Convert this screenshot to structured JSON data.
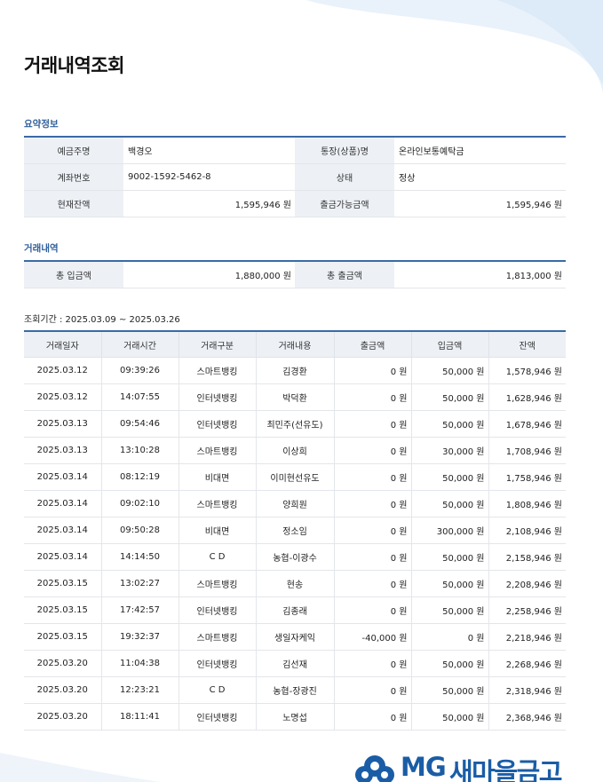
{
  "page": {
    "title": "거래내역조회"
  },
  "summary": {
    "section_title": "요약정보",
    "rows": [
      {
        "label1": "예금주명",
        "value1": "백경오",
        "label2": "통장(상품)명",
        "value2": "온라인보통예탁금"
      },
      {
        "label1": "계좌번호",
        "value1": "9002-1592-5462-8",
        "label2": "상태",
        "value2": "정상"
      },
      {
        "label1": "현재잔액",
        "value1": "1,595,946 원",
        "label2": "출금가능금액",
        "value2": "1,595,946 원"
      }
    ]
  },
  "totals": {
    "section_title": "거래내역",
    "deposit_label": "총 입금액",
    "deposit_value": "1,880,000 원",
    "withdraw_label": "총 출금액",
    "withdraw_value": "1,813,000 원"
  },
  "period": {
    "text": "조회기간 : 2025.03.09 ~ 2025.03.26"
  },
  "transactions": {
    "headers": [
      "거래일자",
      "거래시간",
      "거래구분",
      "거래내용",
      "출금액",
      "입금액",
      "잔액"
    ],
    "rows": [
      [
        "2025.03.12",
        "09:39:26",
        "스마트뱅킹",
        "김경환",
        "0 원",
        "50,000 원",
        "1,578,946 원"
      ],
      [
        "2025.03.12",
        "14:07:55",
        "인터넷뱅킹",
        "박덕환",
        "0 원",
        "50,000 원",
        "1,628,946 원"
      ],
      [
        "2025.03.13",
        "09:54:46",
        "인터넷뱅킹",
        "최민주(선유도)",
        "0 원",
        "50,000 원",
        "1,678,946 원"
      ],
      [
        "2025.03.13",
        "13:10:28",
        "스마트뱅킹",
        "이상희",
        "0 원",
        "30,000 원",
        "1,708,946 원"
      ],
      [
        "2025.03.14",
        "08:12:19",
        "비대면",
        "이미현선유도",
        "0 원",
        "50,000 원",
        "1,758,946 원"
      ],
      [
        "2025.03.14",
        "09:02:10",
        "스마트뱅킹",
        "양희원",
        "0 원",
        "50,000 원",
        "1,808,946 원"
      ],
      [
        "2025.03.14",
        "09:50:28",
        "비대면",
        "정소임",
        "0 원",
        "300,000 원",
        "2,108,946 원"
      ],
      [
        "2025.03.14",
        "14:14:50",
        "C D",
        "농협-이광수",
        "0 원",
        "50,000 원",
        "2,158,946 원"
      ],
      [
        "2025.03.15",
        "13:02:27",
        "스마트뱅킹",
        "현송",
        "0 원",
        "50,000 원",
        "2,208,946 원"
      ],
      [
        "2025.03.15",
        "17:42:57",
        "인터넷뱅킹",
        "김종래",
        "0 원",
        "50,000 원",
        "2,258,946 원"
      ],
      [
        "2025.03.15",
        "19:32:37",
        "스마트뱅킹",
        "생일자케익",
        "-40,000 원",
        "0 원",
        "2,218,946 원"
      ],
      [
        "2025.03.20",
        "11:04:38",
        "인터넷뱅킹",
        "김선재",
        "0 원",
        "50,000 원",
        "2,268,946 원"
      ],
      [
        "2025.03.20",
        "12:23:21",
        "C D",
        "농협-장광진",
        "0 원",
        "50,000 원",
        "2,318,946 원"
      ],
      [
        "2025.03.20",
        "18:11:41",
        "인터넷뱅킹",
        "노명섭",
        "0 원",
        "50,000 원",
        "2,368,946 원"
      ]
    ]
  },
  "logo": {
    "text_latin": "MG",
    "text_korean": "새마을금고",
    "icon": "mg-cloud-logo-icon"
  },
  "colors": {
    "accent": "#3a6aa6",
    "section_title": "#2f5f9a",
    "label_bg": "#edf1f6",
    "brand": "#1a5da6"
  }
}
